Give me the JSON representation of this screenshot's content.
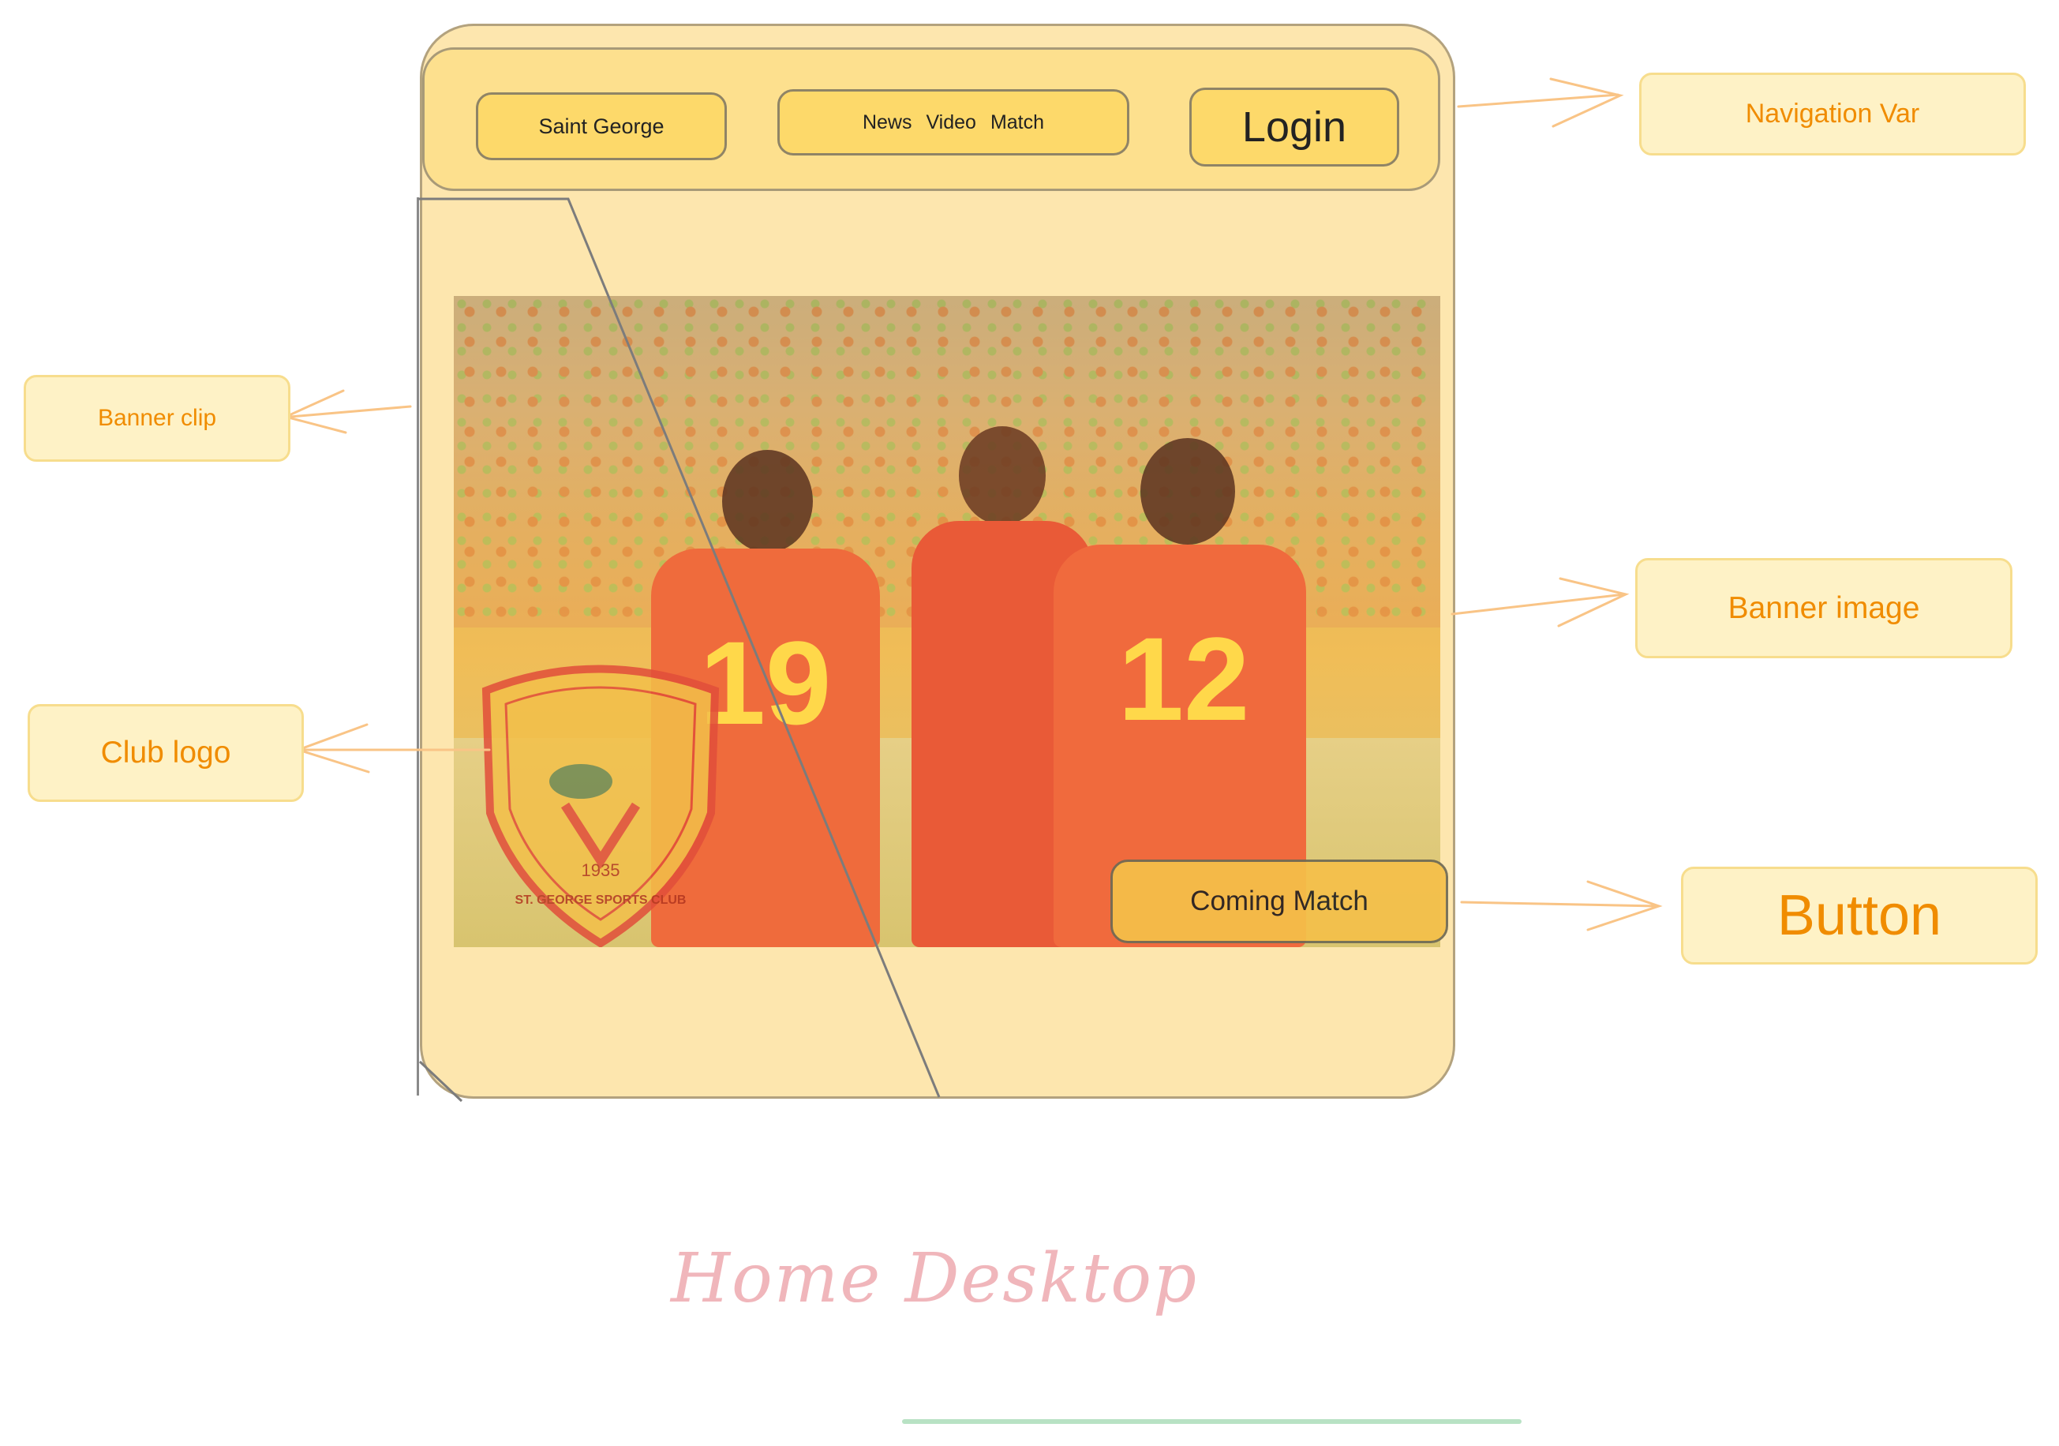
{
  "navbar": {
    "brand": "Saint George",
    "links": [
      "News",
      "Video",
      "Match"
    ],
    "login": "Login"
  },
  "banner": {
    "button_label": "Coming Match",
    "shirt_numbers": [
      "19",
      "12"
    ],
    "logo_text": {
      "year": "1935",
      "club_name": "ST. GEORGE SPORTS CLUB"
    }
  },
  "annotations": {
    "navigation": "Navigation Var",
    "banner_clip": "Banner clip",
    "banner_image": "Banner image",
    "club_logo": "Club logo",
    "button": "Button"
  },
  "page_title": "Home Desktop",
  "colors": {
    "frame": "#fde6ae",
    "navbar": "#fde08e",
    "nav_button": "#fdd96a",
    "callout_text": "#f08c00",
    "callout_bg": "#fef2c6",
    "title": "#f0b6bb"
  }
}
